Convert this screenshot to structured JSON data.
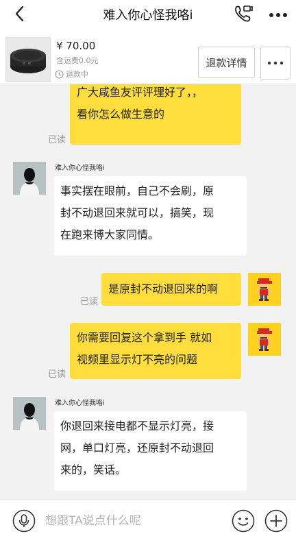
{
  "header": {
    "title": "难入你心怪我咯i",
    "back_icon": "chevron-left-icon",
    "call_icon": "phone-video-icon",
    "more_icon": "more-dots-icon"
  },
  "product": {
    "price": "¥ 70.00",
    "shipping": "含运费0.0元",
    "status": "退款中",
    "refund_details_button": "退款详情",
    "more_icon": "more-dots-icon"
  },
  "messages": [
    {
      "from": "me",
      "text_line1": "广大咸鱼友评评理好了，，",
      "text_line2": "看你怎么做生意的",
      "read": "已读"
    },
    {
      "from": "them",
      "sender": "难入你心怪我咯i",
      "text_line1": "事实摆在眼前，自己不会刷，原",
      "text_line2": "封不动退回来就可以，搞笑，现",
      "text_line3": "在跑来博大家同情。"
    },
    {
      "from": "me",
      "text_line1": "是原封不动退回来的啊",
      "read": "已读"
    },
    {
      "from": "me",
      "text_line1": "你需要回复这个拿到手 就如",
      "text_line2": "视频里显示灯不亮的问题",
      "read": "已读"
    },
    {
      "from": "them",
      "sender": "难入你心怪我咯i",
      "text_line1": "你退回来接电都不显示灯亮，接",
      "text_line2": "网，单口灯亮，还原封不动退回",
      "text_line3": "来的，笑话。"
    }
  ],
  "input": {
    "placeholder": "想跟TA说点什么呢"
  },
  "colors": {
    "my_bubble": "#ffdd3c",
    "their_bubble": "#ffffff",
    "background": "#f2f2f2"
  }
}
